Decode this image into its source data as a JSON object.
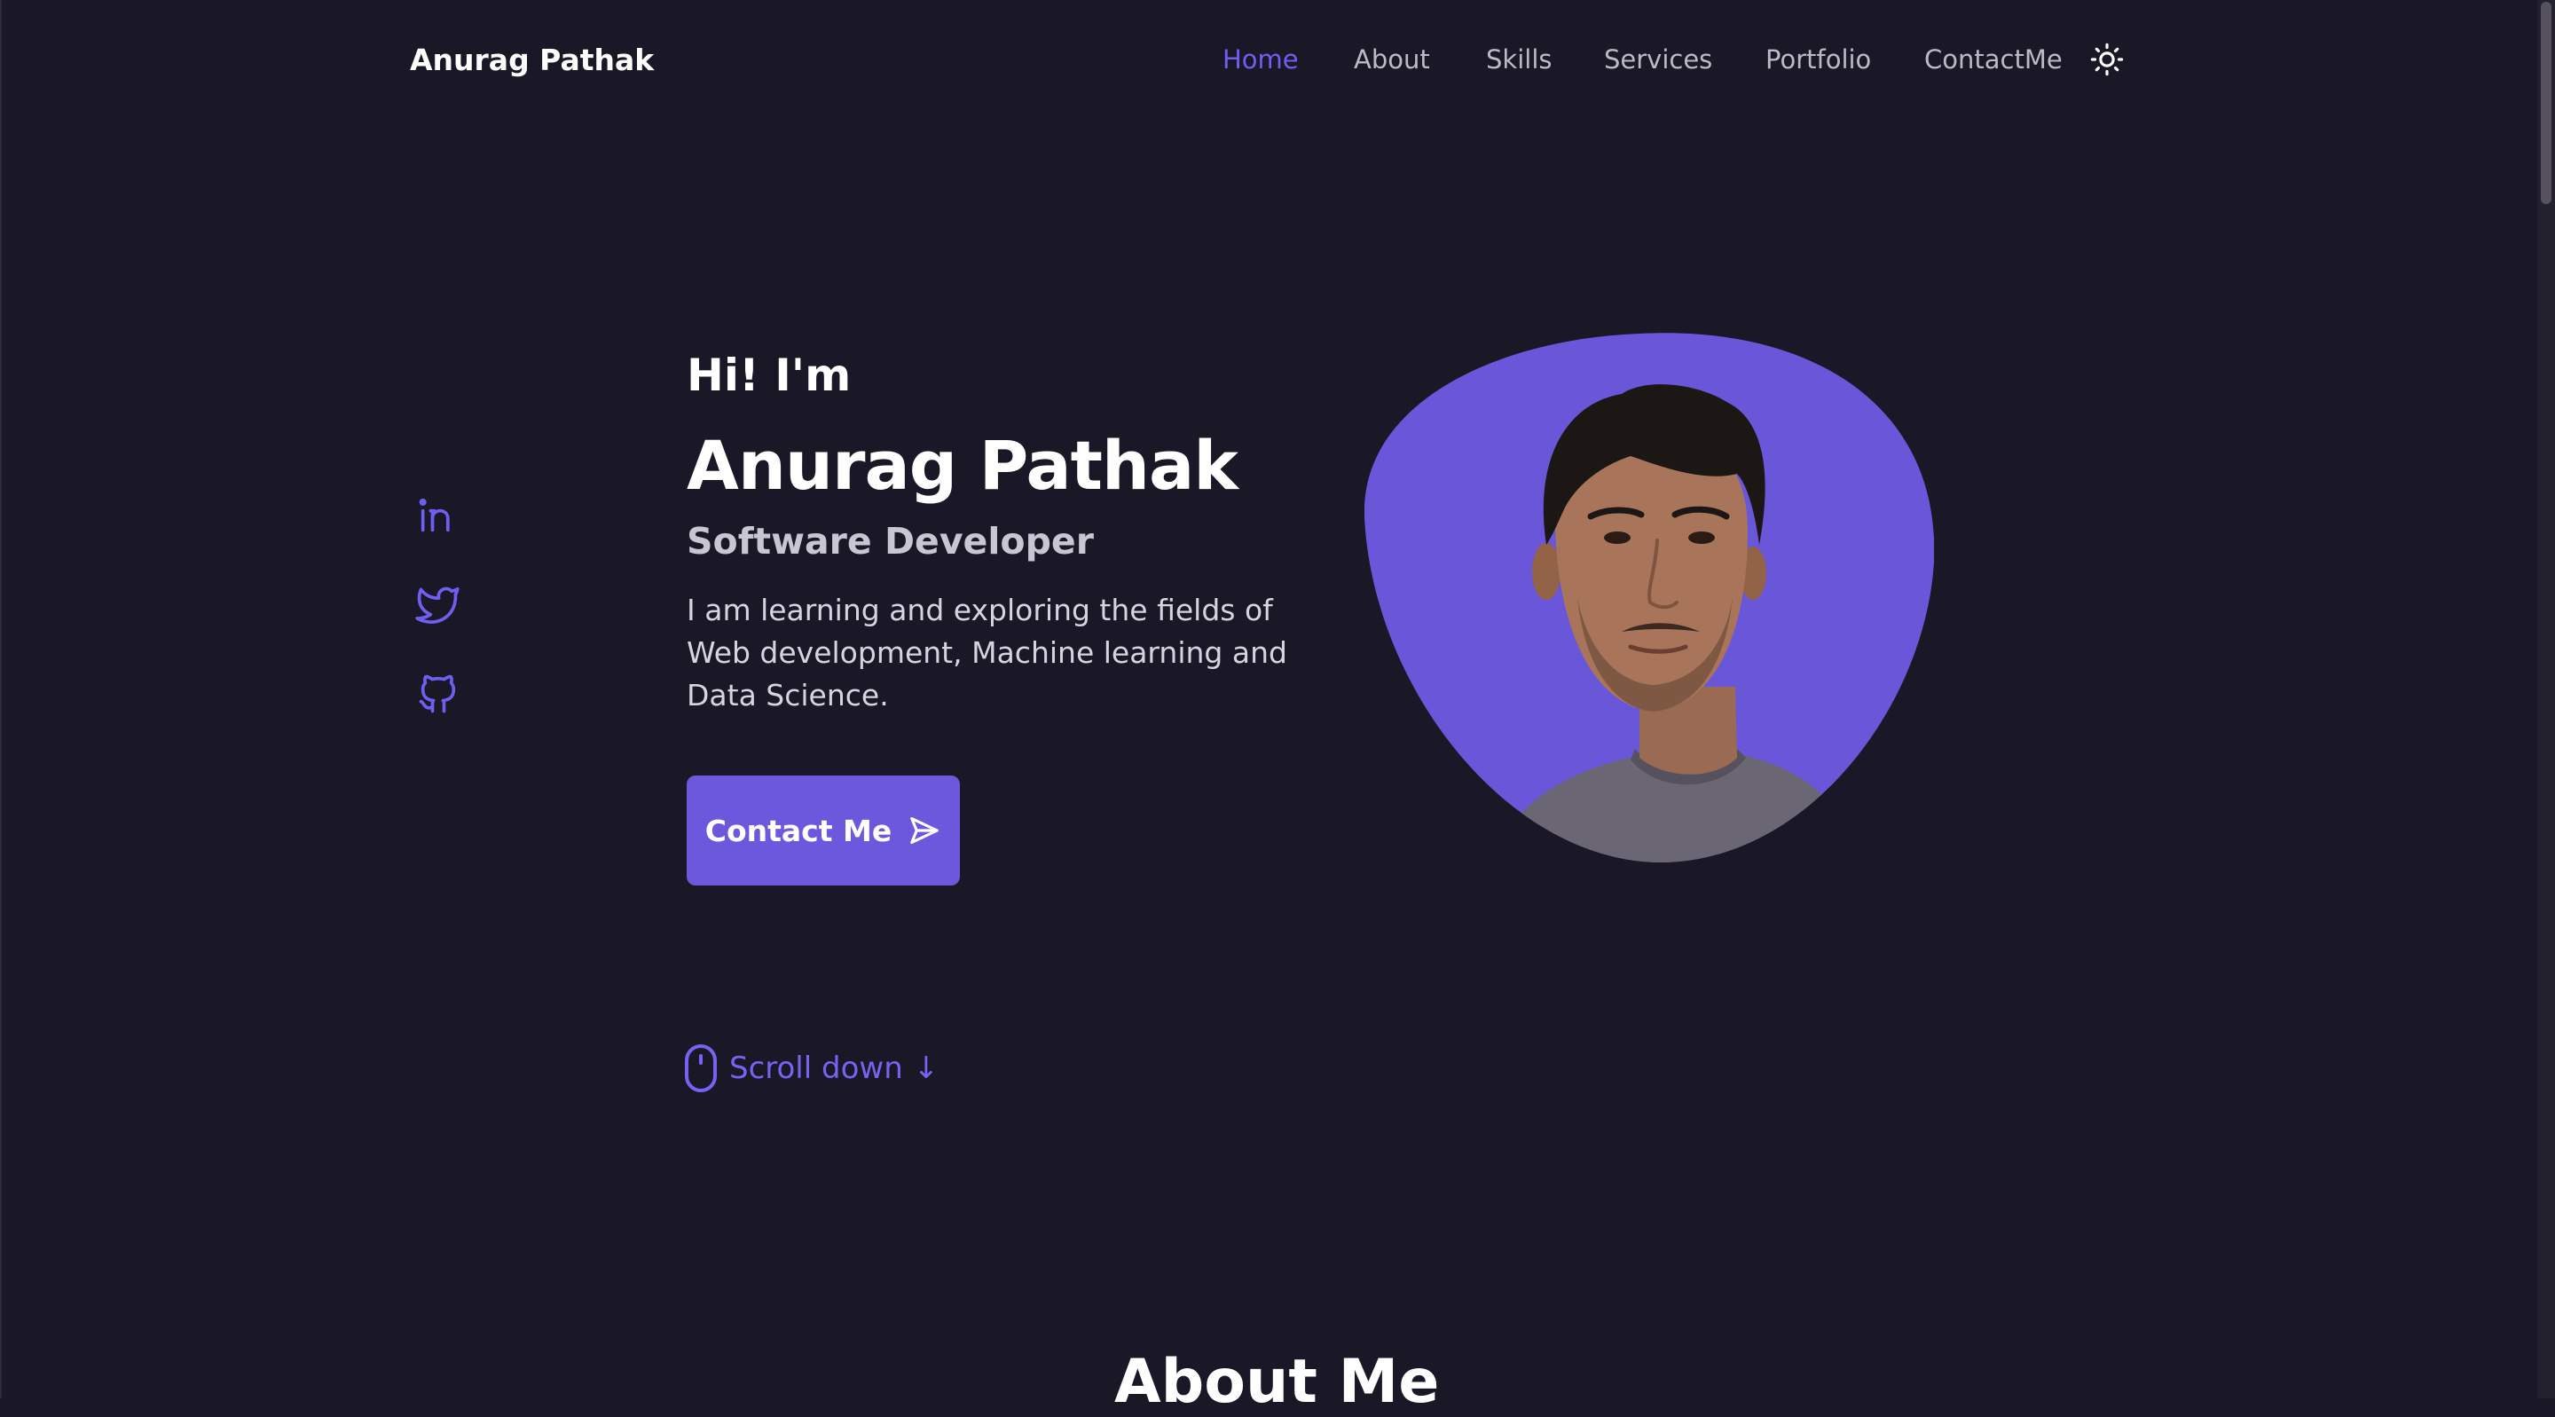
{
  "nav": {
    "brand": "Anurag Pathak",
    "links": [
      {
        "label": "Home",
        "active": true
      },
      {
        "label": "About",
        "active": false
      },
      {
        "label": "Skills",
        "active": false
      },
      {
        "label": "Services",
        "active": false
      },
      {
        "label": "Portfolio",
        "active": false
      },
      {
        "label": "ContactMe",
        "active": false
      }
    ],
    "theme_icon": "sun-icon"
  },
  "social": [
    {
      "icon": "linkedin-icon"
    },
    {
      "icon": "twitter-icon"
    },
    {
      "icon": "github-icon"
    }
  ],
  "hero": {
    "greeting": "Hi! I'm",
    "name": "Anurag Pathak",
    "role": "Software Developer",
    "description": "I am learning and exploring the fields of Web development, Machine learning and Data Science.",
    "cta_label": "Contact Me",
    "cta_icon": "send-icon",
    "scroll_label": "Scroll down",
    "scroll_arrow": "↓",
    "scroll_icon": "mouse-icon",
    "image": "profile-photo"
  },
  "about": {
    "title": "About Me"
  },
  "colors": {
    "background": "#1a1727",
    "accent": "#6c58dd",
    "accent_text": "#6f5ff0",
    "text": "#ffffff",
    "muted_text": "#bdbac6"
  }
}
